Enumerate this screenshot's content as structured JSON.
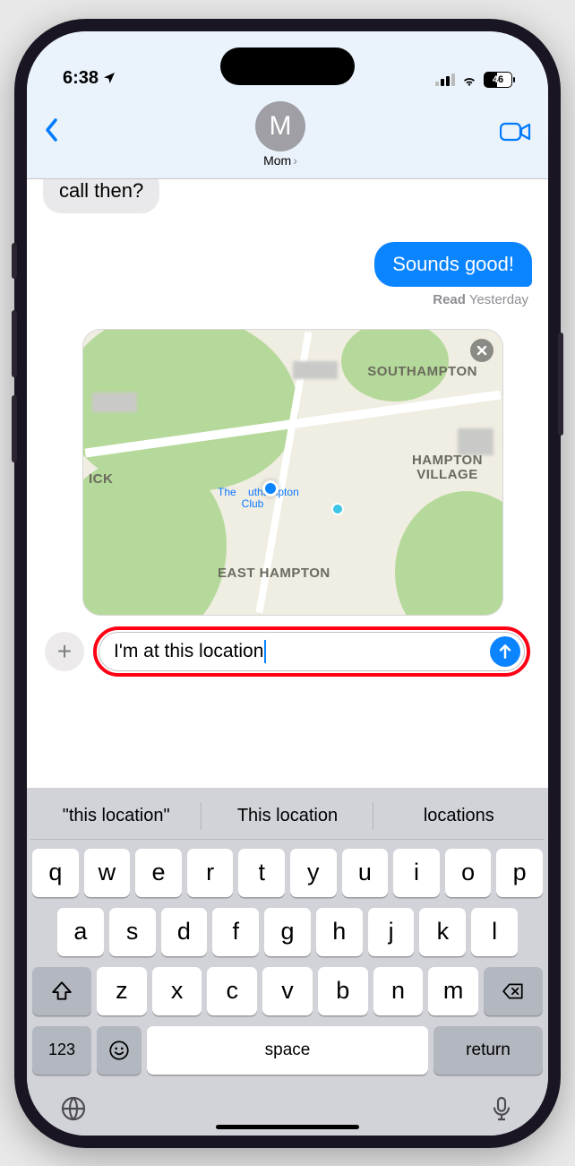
{
  "status_bar": {
    "time": "6:38",
    "battery": "46"
  },
  "header": {
    "avatar_initial": "M",
    "contact_name": "Mom"
  },
  "messages": {
    "incoming_snippet": "call then?",
    "outgoing": "Sounds good!",
    "receipt_prefix": "Read",
    "receipt_time": "Yesterday"
  },
  "map": {
    "labels": {
      "ne": "SOUTHAMPTON",
      "e1": "HAMPTON",
      "e2": "VILLAGE",
      "s": "EAST HAMPTON",
      "w": "ICK"
    },
    "poi_l1": "The",
    "poi_l2": "uthampton",
    "poi_l3": "Club"
  },
  "compose": {
    "value": "I'm at this location"
  },
  "suggestions": [
    "\"this location\"",
    "This location",
    "locations"
  ],
  "keyboard": {
    "row1": [
      "q",
      "w",
      "e",
      "r",
      "t",
      "y",
      "u",
      "i",
      "o",
      "p"
    ],
    "row2": [
      "a",
      "s",
      "d",
      "f",
      "g",
      "h",
      "j",
      "k",
      "l"
    ],
    "row3": [
      "z",
      "x",
      "c",
      "v",
      "b",
      "n",
      "m"
    ],
    "numkey": "123",
    "space": "space",
    "return": "return"
  }
}
